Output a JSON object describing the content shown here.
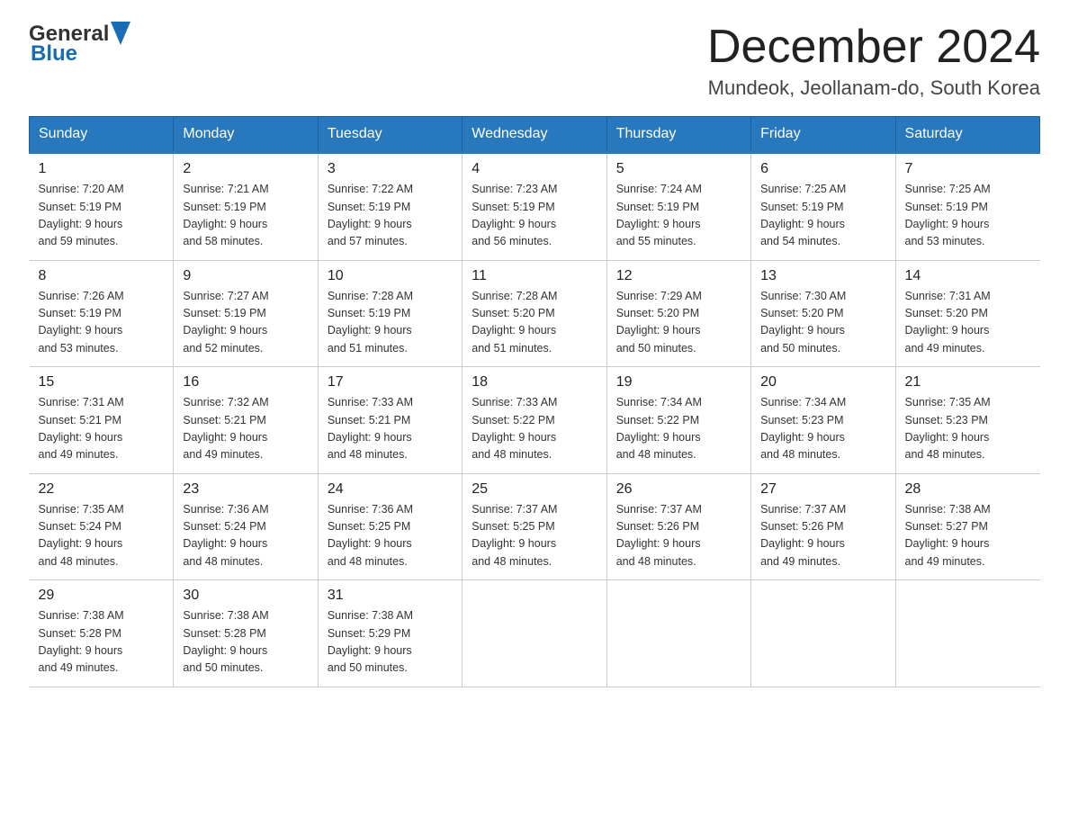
{
  "header": {
    "logo_general": "General",
    "logo_blue": "Blue",
    "title": "December 2024",
    "subtitle": "Mundeok, Jeollanam-do, South Korea"
  },
  "weekdays": [
    "Sunday",
    "Monday",
    "Tuesday",
    "Wednesday",
    "Thursday",
    "Friday",
    "Saturday"
  ],
  "weeks": [
    [
      {
        "day": "1",
        "sunrise": "Sunrise: 7:20 AM",
        "sunset": "Sunset: 5:19 PM",
        "daylight": "Daylight: 9 hours",
        "minutes": "and 59 minutes."
      },
      {
        "day": "2",
        "sunrise": "Sunrise: 7:21 AM",
        "sunset": "Sunset: 5:19 PM",
        "daylight": "Daylight: 9 hours",
        "minutes": "and 58 minutes."
      },
      {
        "day": "3",
        "sunrise": "Sunrise: 7:22 AM",
        "sunset": "Sunset: 5:19 PM",
        "daylight": "Daylight: 9 hours",
        "minutes": "and 57 minutes."
      },
      {
        "day": "4",
        "sunrise": "Sunrise: 7:23 AM",
        "sunset": "Sunset: 5:19 PM",
        "daylight": "Daylight: 9 hours",
        "minutes": "and 56 minutes."
      },
      {
        "day": "5",
        "sunrise": "Sunrise: 7:24 AM",
        "sunset": "Sunset: 5:19 PM",
        "daylight": "Daylight: 9 hours",
        "minutes": "and 55 minutes."
      },
      {
        "day": "6",
        "sunrise": "Sunrise: 7:25 AM",
        "sunset": "Sunset: 5:19 PM",
        "daylight": "Daylight: 9 hours",
        "minutes": "and 54 minutes."
      },
      {
        "day": "7",
        "sunrise": "Sunrise: 7:25 AM",
        "sunset": "Sunset: 5:19 PM",
        "daylight": "Daylight: 9 hours",
        "minutes": "and 53 minutes."
      }
    ],
    [
      {
        "day": "8",
        "sunrise": "Sunrise: 7:26 AM",
        "sunset": "Sunset: 5:19 PM",
        "daylight": "Daylight: 9 hours",
        "minutes": "and 53 minutes."
      },
      {
        "day": "9",
        "sunrise": "Sunrise: 7:27 AM",
        "sunset": "Sunset: 5:19 PM",
        "daylight": "Daylight: 9 hours",
        "minutes": "and 52 minutes."
      },
      {
        "day": "10",
        "sunrise": "Sunrise: 7:28 AM",
        "sunset": "Sunset: 5:19 PM",
        "daylight": "Daylight: 9 hours",
        "minutes": "and 51 minutes."
      },
      {
        "day": "11",
        "sunrise": "Sunrise: 7:28 AM",
        "sunset": "Sunset: 5:20 PM",
        "daylight": "Daylight: 9 hours",
        "minutes": "and 51 minutes."
      },
      {
        "day": "12",
        "sunrise": "Sunrise: 7:29 AM",
        "sunset": "Sunset: 5:20 PM",
        "daylight": "Daylight: 9 hours",
        "minutes": "and 50 minutes."
      },
      {
        "day": "13",
        "sunrise": "Sunrise: 7:30 AM",
        "sunset": "Sunset: 5:20 PM",
        "daylight": "Daylight: 9 hours",
        "minutes": "and 50 minutes."
      },
      {
        "day": "14",
        "sunrise": "Sunrise: 7:31 AM",
        "sunset": "Sunset: 5:20 PM",
        "daylight": "Daylight: 9 hours",
        "minutes": "and 49 minutes."
      }
    ],
    [
      {
        "day": "15",
        "sunrise": "Sunrise: 7:31 AM",
        "sunset": "Sunset: 5:21 PM",
        "daylight": "Daylight: 9 hours",
        "minutes": "and 49 minutes."
      },
      {
        "day": "16",
        "sunrise": "Sunrise: 7:32 AM",
        "sunset": "Sunset: 5:21 PM",
        "daylight": "Daylight: 9 hours",
        "minutes": "and 49 minutes."
      },
      {
        "day": "17",
        "sunrise": "Sunrise: 7:33 AM",
        "sunset": "Sunset: 5:21 PM",
        "daylight": "Daylight: 9 hours",
        "minutes": "and 48 minutes."
      },
      {
        "day": "18",
        "sunrise": "Sunrise: 7:33 AM",
        "sunset": "Sunset: 5:22 PM",
        "daylight": "Daylight: 9 hours",
        "minutes": "and 48 minutes."
      },
      {
        "day": "19",
        "sunrise": "Sunrise: 7:34 AM",
        "sunset": "Sunset: 5:22 PM",
        "daylight": "Daylight: 9 hours",
        "minutes": "and 48 minutes."
      },
      {
        "day": "20",
        "sunrise": "Sunrise: 7:34 AM",
        "sunset": "Sunset: 5:23 PM",
        "daylight": "Daylight: 9 hours",
        "minutes": "and 48 minutes."
      },
      {
        "day": "21",
        "sunrise": "Sunrise: 7:35 AM",
        "sunset": "Sunset: 5:23 PM",
        "daylight": "Daylight: 9 hours",
        "minutes": "and 48 minutes."
      }
    ],
    [
      {
        "day": "22",
        "sunrise": "Sunrise: 7:35 AM",
        "sunset": "Sunset: 5:24 PM",
        "daylight": "Daylight: 9 hours",
        "minutes": "and 48 minutes."
      },
      {
        "day": "23",
        "sunrise": "Sunrise: 7:36 AM",
        "sunset": "Sunset: 5:24 PM",
        "daylight": "Daylight: 9 hours",
        "minutes": "and 48 minutes."
      },
      {
        "day": "24",
        "sunrise": "Sunrise: 7:36 AM",
        "sunset": "Sunset: 5:25 PM",
        "daylight": "Daylight: 9 hours",
        "minutes": "and 48 minutes."
      },
      {
        "day": "25",
        "sunrise": "Sunrise: 7:37 AM",
        "sunset": "Sunset: 5:25 PM",
        "daylight": "Daylight: 9 hours",
        "minutes": "and 48 minutes."
      },
      {
        "day": "26",
        "sunrise": "Sunrise: 7:37 AM",
        "sunset": "Sunset: 5:26 PM",
        "daylight": "Daylight: 9 hours",
        "minutes": "and 48 minutes."
      },
      {
        "day": "27",
        "sunrise": "Sunrise: 7:37 AM",
        "sunset": "Sunset: 5:26 PM",
        "daylight": "Daylight: 9 hours",
        "minutes": "and 49 minutes."
      },
      {
        "day": "28",
        "sunrise": "Sunrise: 7:38 AM",
        "sunset": "Sunset: 5:27 PM",
        "daylight": "Daylight: 9 hours",
        "minutes": "and 49 minutes."
      }
    ],
    [
      {
        "day": "29",
        "sunrise": "Sunrise: 7:38 AM",
        "sunset": "Sunset: 5:28 PM",
        "daylight": "Daylight: 9 hours",
        "minutes": "and 49 minutes."
      },
      {
        "day": "30",
        "sunrise": "Sunrise: 7:38 AM",
        "sunset": "Sunset: 5:28 PM",
        "daylight": "Daylight: 9 hours",
        "minutes": "and 50 minutes."
      },
      {
        "day": "31",
        "sunrise": "Sunrise: 7:38 AM",
        "sunset": "Sunset: 5:29 PM",
        "daylight": "Daylight: 9 hours",
        "minutes": "and 50 minutes."
      },
      null,
      null,
      null,
      null
    ]
  ]
}
